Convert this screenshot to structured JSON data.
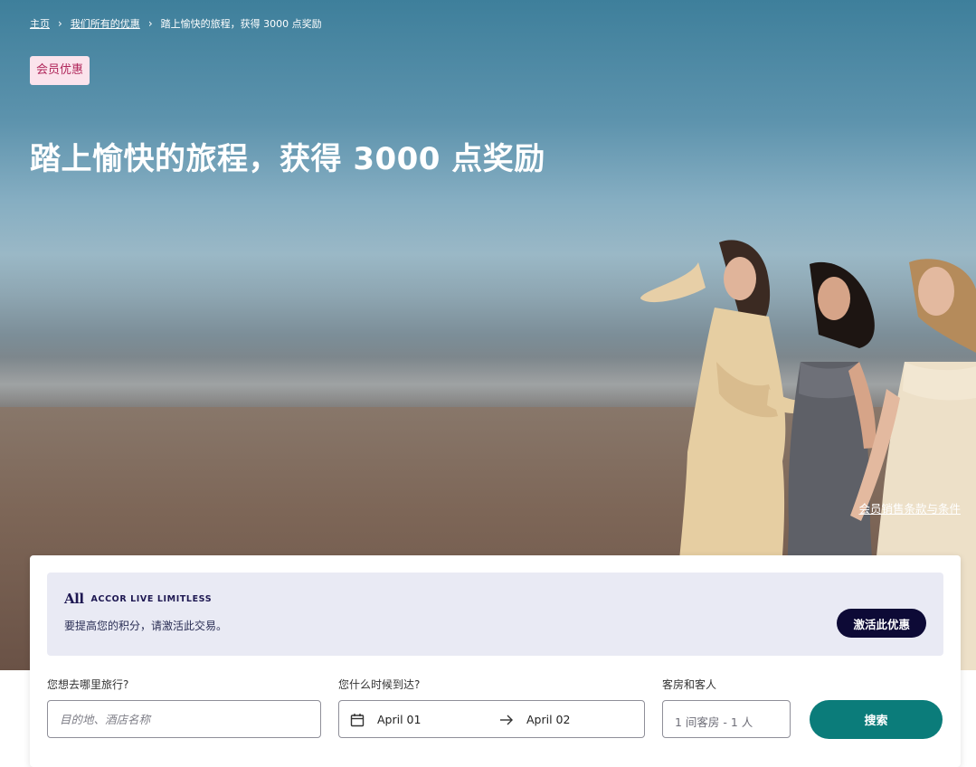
{
  "breadcrumb": {
    "home": "主页",
    "offers": "我们所有的优惠",
    "current": "踏上愉快的旅程，获得 3000 点奖励",
    "separator": "›"
  },
  "hero": {
    "badge": "会员优惠",
    "title": "踏上愉快的旅程，获得 3000 点奖励",
    "terms_link": "会员销售条款与条件"
  },
  "loyalty": {
    "logo_mark": "All",
    "brand": "ACCOR LIVE LIMITLESS",
    "message": "要提高您的积分，请激活此交易。",
    "activate_label": "激活此优惠"
  },
  "search": {
    "destination_label": "您想去哪里旅行?",
    "destination_placeholder": "目的地、酒店名称",
    "dates_label": "您什么时候到达?",
    "checkin": "April 01",
    "checkout": "April 02",
    "rooms_label": "客房和客人",
    "rooms_value": "1 间客房 - 1 人",
    "search_label": "搜索"
  },
  "colors": {
    "badge_bg": "#fbe3ec",
    "badge_text": "#b0265a",
    "loyalty_bg": "#e9eaf4",
    "activate_bg": "#0d0a36",
    "search_bg": "#0b7c7a"
  }
}
